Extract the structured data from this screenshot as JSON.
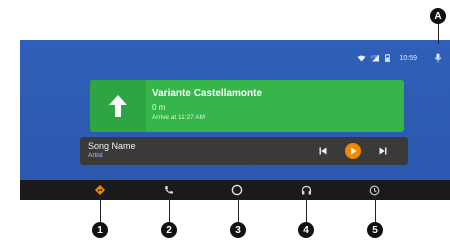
{
  "status": {
    "time": "10:59",
    "icons": [
      "wifi-icon",
      "signal-icon",
      "battery-icon"
    ]
  },
  "navigation": {
    "street": "Variante Castellamonte",
    "distance": "0 m",
    "arrival": "Arrive at 11:27 AM",
    "maneuver_icon": "arrow-straight-up-icon"
  },
  "media": {
    "song": "Song Name",
    "artist": "Artist",
    "controls": [
      "skip-previous-icon",
      "play-icon",
      "skip-next-icon"
    ]
  },
  "bottom_nav": [
    "navigation-icon",
    "phone-icon",
    "home-circle-icon",
    "headphones-icon",
    "recents-icon"
  ],
  "callouts": {
    "a": "A",
    "n1": "1",
    "n2": "2",
    "n3": "3",
    "n4": "4",
    "n5": "5"
  },
  "colors": {
    "screen_bg": "#2b58ad",
    "nav_card": "#35b54a",
    "media_card": "#3a3a3a",
    "nav_bar": "#1a1a1a",
    "play_accent": "#f28a00",
    "artist_text": "#a3c5ff"
  }
}
